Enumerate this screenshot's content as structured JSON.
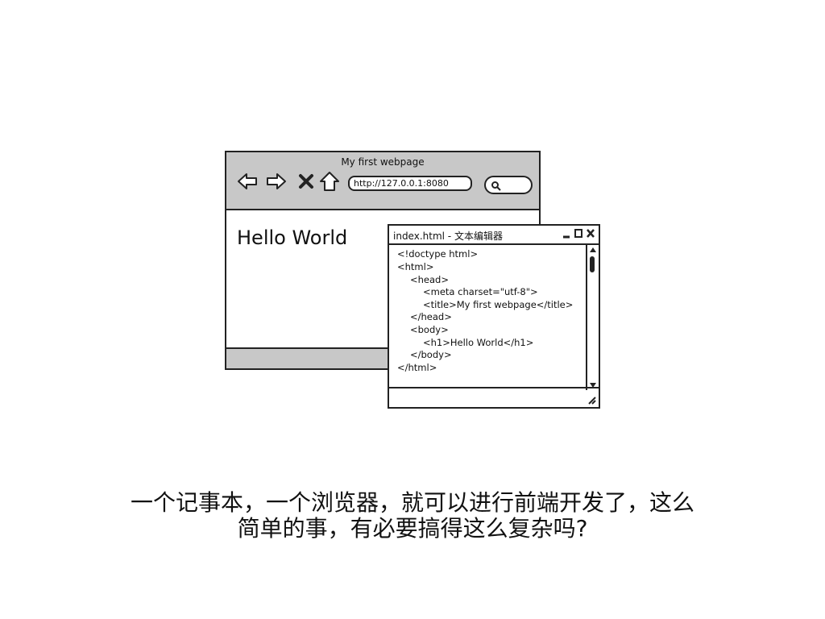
{
  "browser": {
    "title": "My first webpage",
    "url": "http://127.0.0.1:8080",
    "heading": "Hello World",
    "nav_icons": [
      "back-icon",
      "forward-icon",
      "stop-icon",
      "home-icon"
    ],
    "search_icon": "search-icon"
  },
  "editor": {
    "title": "index.html - 文本编辑器",
    "window_buttons": [
      "minimize-icon",
      "maximize-icon",
      "close-icon"
    ],
    "code_lines": [
      "<!doctype html>",
      "<html>",
      "<head>",
      "<meta charset=\"utf-8\">",
      "<title>My first webpage</title>",
      "</head>",
      "<body>",
      "<h1>Hello World</h1>",
      "</body>",
      "</html>"
    ]
  },
  "caption": {
    "line1": "一个记事本，一个浏览器，就可以进行前端开发了，这么",
    "line2": "简单的事，有必要搞得这么复杂吗?"
  }
}
